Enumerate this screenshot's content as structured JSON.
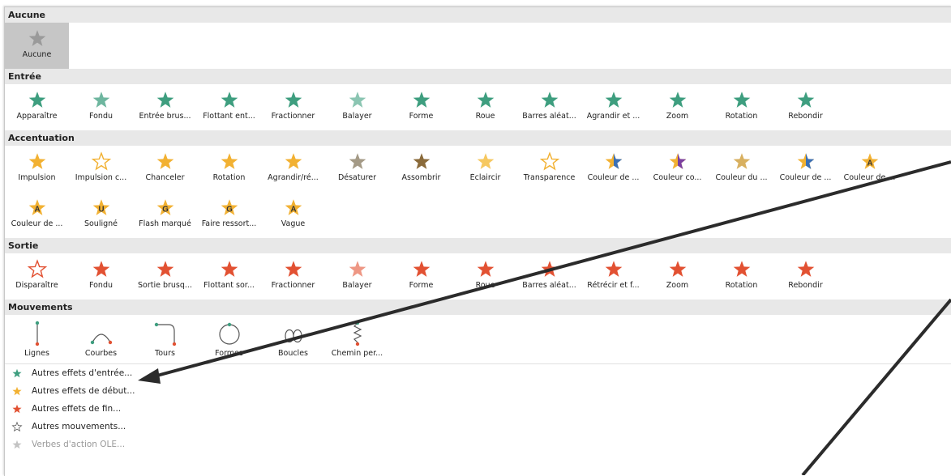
{
  "sections": {
    "none": {
      "title": "Aucune",
      "items": [
        {
          "label": "Aucune",
          "icon": "star-none-icon"
        }
      ]
    },
    "entrance": {
      "title": "Entrée",
      "items": [
        {
          "label": "Apparaître",
          "icon": "appear-icon"
        },
        {
          "label": "Fondu",
          "icon": "fade-icon"
        },
        {
          "label": "Entrée brus...",
          "icon": "fly-in-icon"
        },
        {
          "label": "Flottant ent...",
          "icon": "float-in-icon"
        },
        {
          "label": "Fractionner",
          "icon": "split-icon"
        },
        {
          "label": "Balayer",
          "icon": "wipe-icon"
        },
        {
          "label": "Forme",
          "icon": "shape-icon"
        },
        {
          "label": "Roue",
          "icon": "wheel-icon"
        },
        {
          "label": "Barres aléat...",
          "icon": "random-bars-icon"
        },
        {
          "label": "Agrandir et ...",
          "icon": "grow-turn-icon"
        },
        {
          "label": "Zoom",
          "icon": "zoom-icon"
        },
        {
          "label": "Rotation",
          "icon": "swivel-icon"
        },
        {
          "label": "Rebondir",
          "icon": "bounce-icon"
        }
      ]
    },
    "emphasis": {
      "title": "Accentuation",
      "rows": [
        [
          {
            "label": "Impulsion",
            "icon": "pulse-icon"
          },
          {
            "label": "Impulsion c...",
            "icon": "color-pulse-icon"
          },
          {
            "label": "Chanceler",
            "icon": "teeter-icon"
          },
          {
            "label": "Rotation",
            "icon": "spin-icon"
          },
          {
            "label": "Agrandir/ré...",
            "icon": "grow-shrink-icon"
          },
          {
            "label": "Désaturer",
            "icon": "desaturate-icon"
          },
          {
            "label": "Assombrir",
            "icon": "darken-icon"
          },
          {
            "label": "Éclaircir",
            "icon": "lighten-icon"
          },
          {
            "label": "Transparence",
            "icon": "transparency-icon"
          },
          {
            "label": "Couleur de ...",
            "icon": "object-color-icon"
          },
          {
            "label": "Couleur co...",
            "icon": "complementary-color-icon"
          },
          {
            "label": "Couleur du ...",
            "icon": "line-color-icon"
          },
          {
            "label": "Couleur de ...",
            "icon": "fill-color-icon"
          },
          {
            "label": "Couleur de ...",
            "icon": "font-color-icon"
          }
        ],
        [
          {
            "label": "Couleur de ...",
            "icon": "brush-color-icon"
          },
          {
            "label": "Souligné",
            "icon": "underline-icon"
          },
          {
            "label": "Flash marqué",
            "icon": "bold-flash-icon"
          },
          {
            "label": "Faire ressort...",
            "icon": "bold-reveal-icon"
          },
          {
            "label": "Vague",
            "icon": "wave-icon"
          }
        ]
      ]
    },
    "exit": {
      "title": "Sortie",
      "items": [
        {
          "label": "Disparaître",
          "icon": "disappear-icon"
        },
        {
          "label": "Fondu",
          "icon": "fade-out-icon"
        },
        {
          "label": "Sortie brusq...",
          "icon": "fly-out-icon"
        },
        {
          "label": "Flottant sor...",
          "icon": "float-out-icon"
        },
        {
          "label": "Fractionner",
          "icon": "split-out-icon"
        },
        {
          "label": "Balayer",
          "icon": "wipe-out-icon"
        },
        {
          "label": "Forme",
          "icon": "shape-out-icon"
        },
        {
          "label": "Roue",
          "icon": "wheel-out-icon"
        },
        {
          "label": "Barres aléat...",
          "icon": "random-bars-out-icon"
        },
        {
          "label": "Rétrécir et f...",
          "icon": "shrink-turn-icon"
        },
        {
          "label": "Zoom",
          "icon": "zoom-out-icon"
        },
        {
          "label": "Rotation",
          "icon": "swivel-out-icon"
        },
        {
          "label": "Rebondir",
          "icon": "bounce-out-icon"
        }
      ]
    },
    "motion": {
      "title": "Mouvements",
      "items": [
        {
          "label": "Lignes",
          "icon": "lines-path-icon"
        },
        {
          "label": "Courbes",
          "icon": "arcs-path-icon"
        },
        {
          "label": "Tours",
          "icon": "turns-path-icon"
        },
        {
          "label": "Formes",
          "icon": "shapes-path-icon"
        },
        {
          "label": "Boucles",
          "icon": "loops-path-icon"
        },
        {
          "label": "Chemin per...",
          "icon": "custom-path-icon"
        }
      ]
    }
  },
  "more": [
    {
      "label": "Autres effets d'entrée...",
      "icon": "more-entrance-icon",
      "enabled": true
    },
    {
      "label": "Autres effets de début...",
      "icon": "more-emphasis-icon",
      "enabled": true
    },
    {
      "label": "Autres effets de fin...",
      "icon": "more-exit-icon",
      "enabled": true
    },
    {
      "label": "Autres mouvements...",
      "icon": "more-motion-icon",
      "enabled": true
    },
    {
      "label": "Verbes d'action OLE...",
      "icon": "ole-verbs-icon",
      "enabled": false
    }
  ],
  "colors": {
    "entrance": "#3e9e7f",
    "emphasis": "#f2b132",
    "exit": "#e25132",
    "none": "#9a9a9a",
    "section_header_bg": "#e8e8e8",
    "selected_bg": "#c6c6c6",
    "annotation_line": "#2b2b2b"
  }
}
